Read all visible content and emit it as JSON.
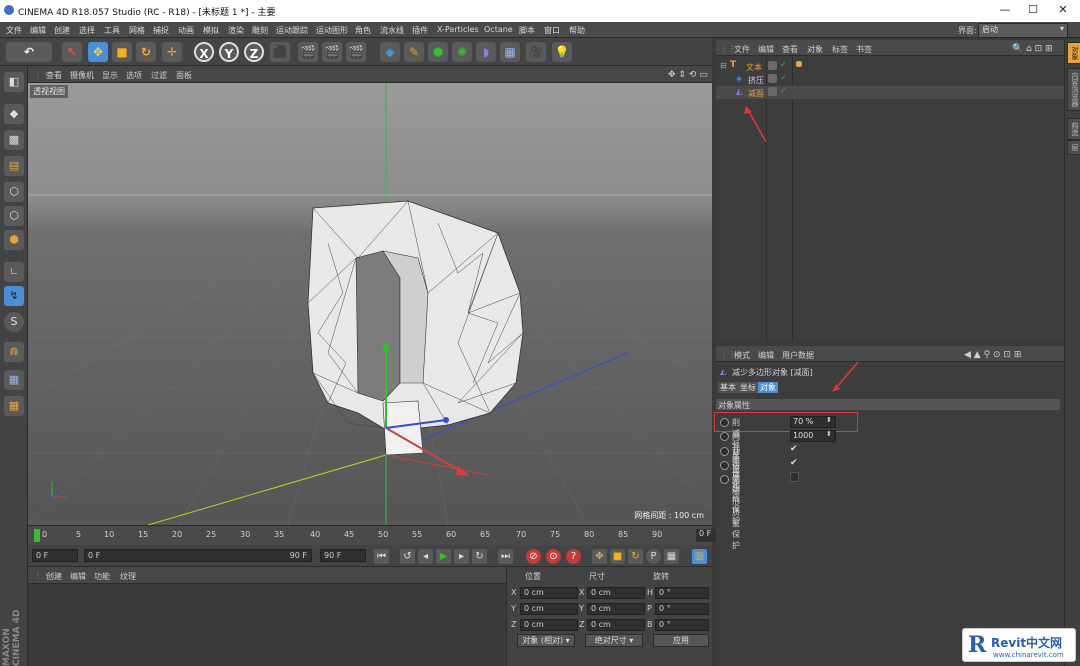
{
  "window": {
    "title": "CINEMA 4D R18.057 Studio (RC - R18) - [未标题 1 *] - 主要",
    "minimize": "—",
    "maximize": "☐",
    "close": "✕"
  },
  "menu": {
    "items": [
      "文件",
      "编辑",
      "创建",
      "选择",
      "工具",
      "网格",
      "捕捉",
      "动画",
      "模拟",
      "渲染",
      "雕刻",
      "运动跟踪",
      "运动图形",
      "角色",
      "流水线",
      "插件",
      "X-Particles",
      "Octane",
      "脚本",
      "窗口",
      "帮助"
    ],
    "layout_label": "界面:",
    "layout_value": "启动"
  },
  "toolbar": {
    "undo_icon": "undo-icon",
    "axis_x": "X",
    "axis_y": "Y",
    "axis_z": "Z"
  },
  "viewport": {
    "menu": [
      "查看",
      "摄像机",
      "显示",
      "选项",
      "过滤",
      "面板"
    ],
    "label": "透视视图",
    "grid_info": "网格间距 : 100 cm"
  },
  "timeline": {
    "ticks": [
      "0",
      "5",
      "10",
      "15",
      "20",
      "25",
      "30",
      "35",
      "40",
      "45",
      "50",
      "55",
      "60",
      "65",
      "70",
      "75",
      "80",
      "85",
      "90"
    ],
    "current_frame": "0 F"
  },
  "playback": {
    "start_frame": "0 F",
    "range_start": "0 F",
    "range_end": "90 F",
    "end_frame": "90 F"
  },
  "material": {
    "menu": [
      "创建",
      "编辑",
      "功能",
      "纹理"
    ]
  },
  "coordinates": {
    "headers": [
      "位置",
      "尺寸",
      "旋转"
    ],
    "rows": [
      {
        "pos_axis": "X",
        "pos": "0 cm",
        "size_axis": "X",
        "size": "0 cm",
        "rot_axis": "H",
        "rot": "0 °"
      },
      {
        "pos_axis": "Y",
        "pos": "0 cm",
        "size_axis": "Y",
        "size": "0 cm",
        "rot_axis": "P",
        "rot": "0 °"
      },
      {
        "pos_axis": "Z",
        "pos": "0 cm",
        "size_axis": "Z",
        "size": "0 cm",
        "rot_axis": "B",
        "rot": "0 °"
      }
    ],
    "mode_select": "对象 (相对)",
    "size_select": "绝对尺寸",
    "apply": "应用"
  },
  "objects": {
    "menu": [
      "文件",
      "编辑",
      "查看",
      "对象",
      "标签",
      "书签"
    ],
    "tree": [
      {
        "name": "文本",
        "icon": "text-object-icon",
        "level": 0
      },
      {
        "name": "挤压",
        "icon": "extrude-icon",
        "level": 1
      },
      {
        "name": "减面",
        "icon": "polygon-reduction-icon",
        "level": 1
      }
    ]
  },
  "side_tabs": [
    "对象",
    "内容浏览器",
    "构造",
    "层"
  ],
  "attributes": {
    "menu": [
      "模式",
      "编辑",
      "用户数据"
    ],
    "object_title": "减少多边形对象 [减面]",
    "tabs": [
      "基本",
      "坐标",
      "对象"
    ],
    "section": "对象属性",
    "props": [
      {
        "label": "削减强度",
        "value": "70 %",
        "type": "field"
      },
      {
        "label": "网孔质量因子",
        "value": "1000",
        "type": "field"
      },
      {
        "label": "共面优化",
        "value": "✔",
        "type": "check"
      },
      {
        "label": "边界曲线保护",
        "value": "✔",
        "type": "check"
      },
      {
        "label": "多边形质量保护",
        "value": "",
        "type": "check"
      }
    ]
  },
  "branding": {
    "maxon": "MAXON CINEMA 4D",
    "watermark_main": "Revit中文网",
    "watermark_url": "www.chinarevit.com"
  },
  "colors": {
    "highlight_red": "#d93a3a",
    "accent_blue": "#4b8fd8",
    "object_orange": "#e8a33a",
    "axis_green": "#30c030"
  }
}
